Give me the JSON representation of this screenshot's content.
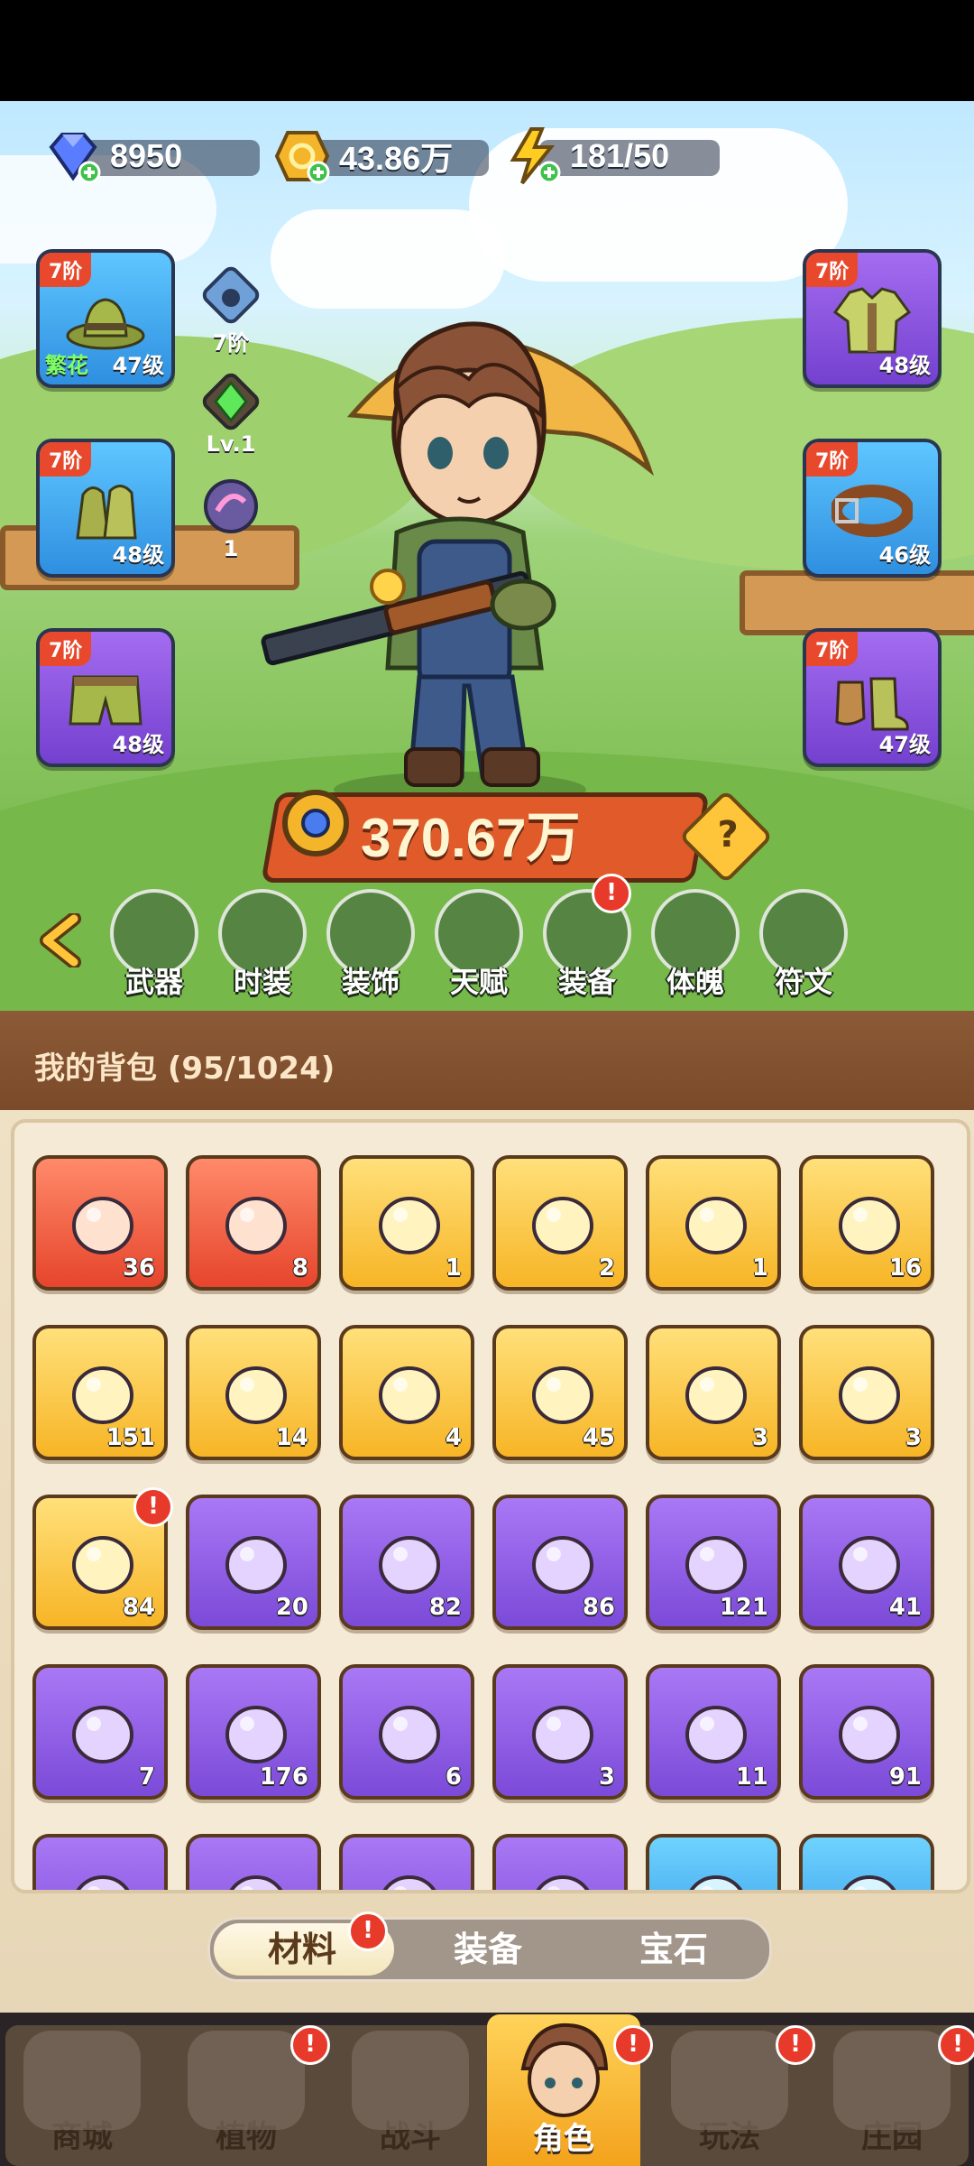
{
  "resources": [
    {
      "name": "diamond",
      "value": "8950",
      "color": "#4a6cf0"
    },
    {
      "name": "gold",
      "value": "43.86万",
      "color": "#f5b52a"
    },
    {
      "name": "energy",
      "value": "181/50",
      "color": "#ffcc22"
    }
  ],
  "equip_left": [
    {
      "tier": "7阶",
      "level": "47级",
      "tag": "繁花",
      "color": "blue",
      "icon": "hat-icon"
    },
    {
      "tier": "7阶",
      "level": "48级",
      "color": "blue",
      "icon": "gloves-icon"
    },
    {
      "tier": "7阶",
      "level": "48级",
      "color": "purple",
      "icon": "shorts-icon"
    }
  ],
  "equip_right": [
    {
      "tier": "7阶",
      "level": "48级",
      "color": "purple",
      "icon": "shirt-icon"
    },
    {
      "tier": "7阶",
      "level": "46级",
      "color": "blue",
      "icon": "belt-icon"
    },
    {
      "tier": "7阶",
      "level": "47级",
      "color": "purple",
      "icon": "boots-icon"
    }
  ],
  "mini": [
    {
      "label": "7阶",
      "icon": "pet-icon"
    },
    {
      "label": "Lv.1",
      "icon": "green-gem-icon"
    },
    {
      "label": "1",
      "icon": "orb-icon"
    }
  ],
  "power": "370.67万",
  "help": "?",
  "tabs": [
    {
      "label": "武器",
      "badge": false
    },
    {
      "label": "时装",
      "badge": false
    },
    {
      "label": "装饰",
      "badge": false
    },
    {
      "label": "天赋",
      "badge": false
    },
    {
      "label": "装备",
      "badge": true
    },
    {
      "label": "体魄",
      "badge": false
    },
    {
      "label": "符文",
      "badge": false
    }
  ],
  "bag_title": "我的背包 (95/1024)",
  "items": [
    {
      "count": "36",
      "bg": "red",
      "icon": "crystal-star-icon"
    },
    {
      "count": "8",
      "bg": "red",
      "icon": "apple-potion-icon"
    },
    {
      "count": "1",
      "bg": "gold",
      "icon": "water-drop-icon"
    },
    {
      "count": "2",
      "bg": "gold",
      "icon": "key-icon"
    },
    {
      "count": "1",
      "bg": "gold",
      "icon": "flower-bud-icon"
    },
    {
      "count": "16",
      "bg": "gold",
      "icon": "rune-stone-icon"
    },
    {
      "count": "151",
      "bg": "gold",
      "icon": "orange-potion-icon"
    },
    {
      "count": "14",
      "bg": "gold",
      "icon": "flower-pot-icon"
    },
    {
      "count": "4",
      "bg": "gold",
      "icon": "sprayer-icon"
    },
    {
      "count": "45",
      "bg": "gold",
      "icon": "spell-book-icon"
    },
    {
      "count": "3",
      "bg": "gold",
      "icon": "glow-flower-icon"
    },
    {
      "count": "3",
      "bg": "gold",
      "icon": "knot-icon"
    },
    {
      "count": "84",
      "bg": "gold",
      "icon": "flame-icon",
      "badge": true
    },
    {
      "count": "20",
      "bg": "purple",
      "icon": "purple-bottle-icon"
    },
    {
      "count": "82",
      "bg": "purple",
      "icon": "leaf-icon"
    },
    {
      "count": "86",
      "bg": "purple",
      "icon": "scroll-icon"
    },
    {
      "count": "121",
      "bg": "purple",
      "icon": "scroll-icon"
    },
    {
      "count": "41",
      "bg": "purple",
      "icon": "scroll-icon"
    },
    {
      "count": "7",
      "bg": "purple",
      "icon": "scroll-icon"
    },
    {
      "count": "176",
      "bg": "purple",
      "icon": "grape-potion-icon"
    },
    {
      "count": "6",
      "bg": "purple",
      "icon": "blue-bulb-icon"
    },
    {
      "count": "3",
      "bg": "purple",
      "icon": "purple-bulb-icon"
    },
    {
      "count": "11",
      "bg": "purple",
      "icon": "watering-can-icon"
    },
    {
      "count": "91",
      "bg": "purple",
      "icon": "fruit-bowl-icon"
    },
    {
      "count": "",
      "bg": "purple",
      "icon": "gold-crystal-icon"
    },
    {
      "count": "",
      "bg": "purple",
      "icon": "pink-crystal-icon"
    },
    {
      "count": "",
      "bg": "purple",
      "icon": "blue-crystal-icon"
    },
    {
      "count": "",
      "bg": "purple",
      "icon": "lily-icon"
    },
    {
      "count": "",
      "bg": "blue",
      "icon": "green-orb-icon"
    },
    {
      "count": "",
      "bg": "blue",
      "icon": "purple-fruit-icon"
    }
  ],
  "segment": [
    {
      "label": "材料",
      "active": true,
      "badge": true
    },
    {
      "label": "装备",
      "active": false
    },
    {
      "label": "宝石",
      "active": false
    }
  ],
  "nav": [
    {
      "label": "商城",
      "badge": false
    },
    {
      "label": "植物",
      "badge": true
    },
    {
      "label": "战斗",
      "badge": false
    },
    {
      "label": "角色",
      "badge": true,
      "active": true
    },
    {
      "label": "玩法",
      "badge": true
    },
    {
      "label": "庄园",
      "badge": true
    }
  ],
  "badge_text": "!"
}
